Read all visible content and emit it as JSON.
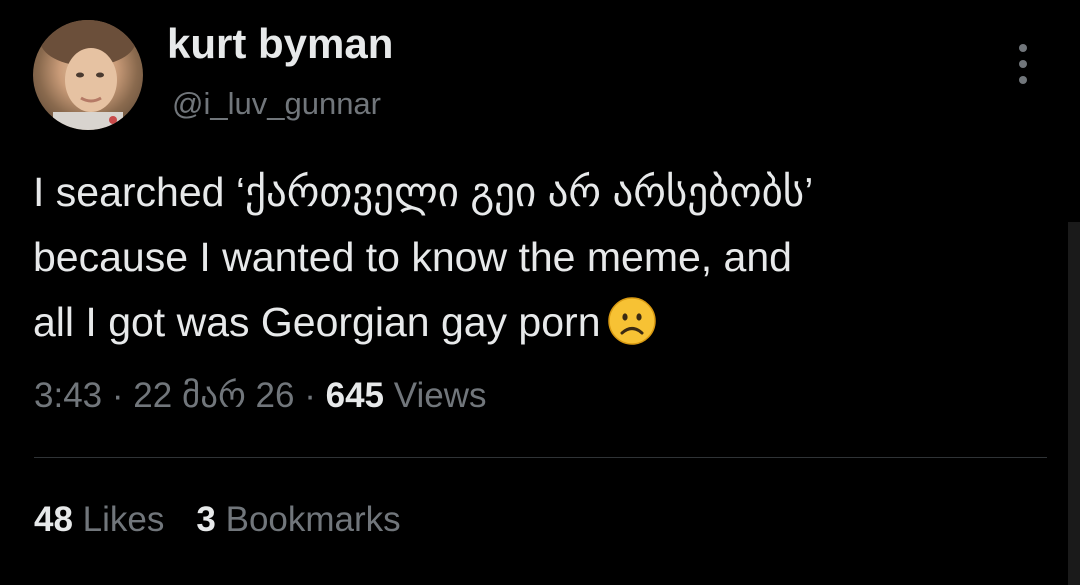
{
  "author": {
    "display_name": "kurt byman",
    "handle": "@i_luv_gunnar"
  },
  "tweet": {
    "text_lines": [
      "I searched ‘ქართველი გეი არ არსებობს’",
      "because I wanted to know the meme, and",
      "all I got was Georgian gay porn"
    ],
    "emoji_icon": "frowning-face-icon"
  },
  "meta": {
    "time": "3:43",
    "separator": "·",
    "date": "22 მარ 26",
    "views_count": "645",
    "views_label": "Views"
  },
  "stats": {
    "likes_count": "48",
    "likes_label": "Likes",
    "bookmarks_count": "3",
    "bookmarks_label": "Bookmarks"
  },
  "colors": {
    "background": "#000000",
    "primary_text": "#e7e9ea",
    "secondary_text": "#71767b",
    "divider": "#2f3336"
  }
}
